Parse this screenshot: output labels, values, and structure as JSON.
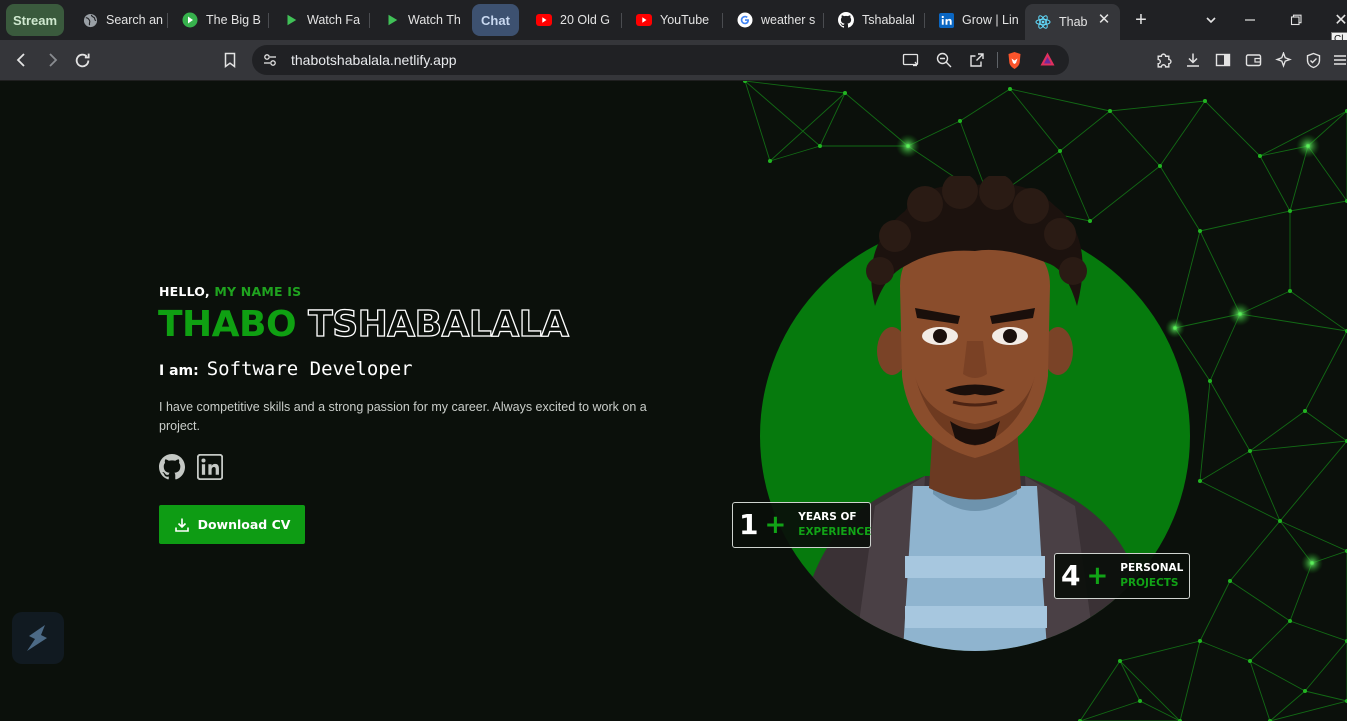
{
  "tabs": [
    {
      "label": "Stream",
      "type": "group",
      "bg": "#3a5a3d",
      "fg": "#cfe8cf"
    },
    {
      "label": "Search an",
      "icon": "globe-icon"
    },
    {
      "label": "The Big B",
      "icon": "play-circle-icon"
    },
    {
      "label": "Watch Fa",
      "icon": "play-icon"
    },
    {
      "label": "Watch Th",
      "icon": "play-icon"
    },
    {
      "label": "Chat",
      "type": "group",
      "bg": "#3d5170",
      "fg": "#c9d8f0"
    },
    {
      "label": "20 Old G",
      "icon": "youtube-icon"
    },
    {
      "label": "YouTube",
      "icon": "youtube-icon"
    },
    {
      "label": "weather s",
      "icon": "google-icon"
    },
    {
      "label": "Tshabalal",
      "icon": "github-icon"
    },
    {
      "label": "Grow | Lin",
      "icon": "linkedin-icon"
    },
    {
      "label": "Thab",
      "icon": "react-icon",
      "active": true
    }
  ],
  "tooltip": "Cl Cl",
  "address": {
    "url": "thabotshabalala.netlify.app"
  },
  "hero": {
    "hello": "HELLO,",
    "hello_accent": "MY NAME IS",
    "first_name": "THABO",
    "last_name": "TSHABALALA",
    "role_label": "I am:",
    "role_value": "Software Developer",
    "description": "I have competitive skills and a strong passion for my career. Always excited to work on a project.",
    "cv_label": "Download CV"
  },
  "stats": [
    {
      "number": "1",
      "plus": "+",
      "line1": "YEARS OF",
      "line2": "EXPERIENCE"
    },
    {
      "number": "4",
      "plus": "+",
      "line1": "PERSONAL",
      "line2": "PROJECTS"
    }
  ],
  "colors": {
    "accent": "#0fa012",
    "circle": "#0a7a10",
    "background": "#0b100b"
  }
}
